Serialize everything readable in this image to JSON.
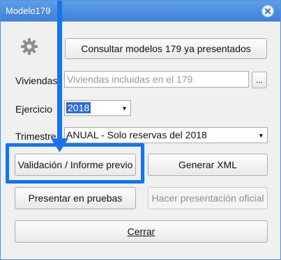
{
  "window": {
    "title": "Modelo179"
  },
  "toolbar": {
    "consultar_label": "Consultar modelos 179 ya presentados"
  },
  "form": {
    "viviendas": {
      "label": "Viviendas",
      "placeholder": "Viviendas incluidas en el 179",
      "browse_label": "..."
    },
    "ejercicio": {
      "label": "Ejercicio",
      "value": "2018"
    },
    "trimestre": {
      "label": "Trimestre",
      "value": "ANUAL - Solo reservas del 2018"
    }
  },
  "actions": {
    "validacion_label": "Validación / Informe previo",
    "generar_xml_label": "Generar XML",
    "presentar_pruebas_label": "Presentar en pruebas",
    "presentacion_oficial_label": "Hacer presentación oficial",
    "cerrar_label": "Cerrar"
  },
  "icons": {
    "settings": "gear-icon",
    "close": "close-icon",
    "dropdown": "chevron-down-icon",
    "annotation": "arrow-down-icon"
  },
  "colors": {
    "titlebar": "#4a8ee0",
    "highlight": "#1a74e8",
    "selection": "#2b6bd2"
  }
}
